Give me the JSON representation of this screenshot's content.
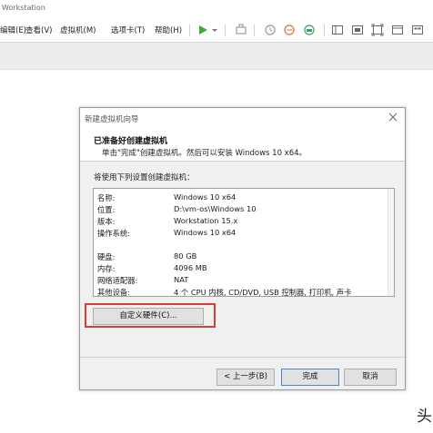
{
  "window": {
    "title": "Workstation"
  },
  "menu": [
    {
      "label": "编辑(E)"
    },
    {
      "label": "查看(V)"
    },
    {
      "label": "虚拟机(M)"
    },
    {
      "label": "选项卡(T)"
    },
    {
      "label": "帮助(H)"
    }
  ],
  "toolbar_icons": [
    "play-icon",
    "dropdown-arrow-icon",
    "send-keys-icon",
    "snapshot-icon",
    "revert-snapshot-icon",
    "manage-snapshots-icon",
    "sidebar-view-icon",
    "console-view-icon",
    "fullscreen-icon",
    "unity-icon",
    "thumbnail-icon"
  ],
  "dialog": {
    "title": "新建虚拟机向导",
    "heading": "已准备好创建虚拟机",
    "subheading": "单击\"完成\"创建虚拟机。然后可以安装 Windows 10 x64。",
    "intro": "将使用下列设置创建虚拟机：",
    "settings": [
      {
        "key": "名称:",
        "value": "Windows 10 x64"
      },
      {
        "key": "位置:",
        "value": "D:\\vm-os\\Windows 10"
      },
      {
        "key": "版本:",
        "value": "Workstation 15.x"
      },
      {
        "key": "操作系统:",
        "value": "Windows 10 x64"
      },
      {
        "key": "",
        "value": ""
      },
      {
        "key": "硬盘:",
        "value": "80 GB"
      },
      {
        "key": "内存:",
        "value": "4096 MB"
      },
      {
        "key": "网络适配器:",
        "value": "NAT"
      },
      {
        "key": "其他设备:",
        "value": "4 个 CPU 内核, CD/DVD, USB 控制器, 打印机, 声卡"
      }
    ],
    "customize_button": "自定义硬件(C)...",
    "back_button": "< 上一步(B)",
    "finish_button": "完成",
    "cancel_button": "取消"
  },
  "watermark": "头条",
  "colors": {
    "highlight": "#d93a3a",
    "play": "#3cab3c"
  }
}
